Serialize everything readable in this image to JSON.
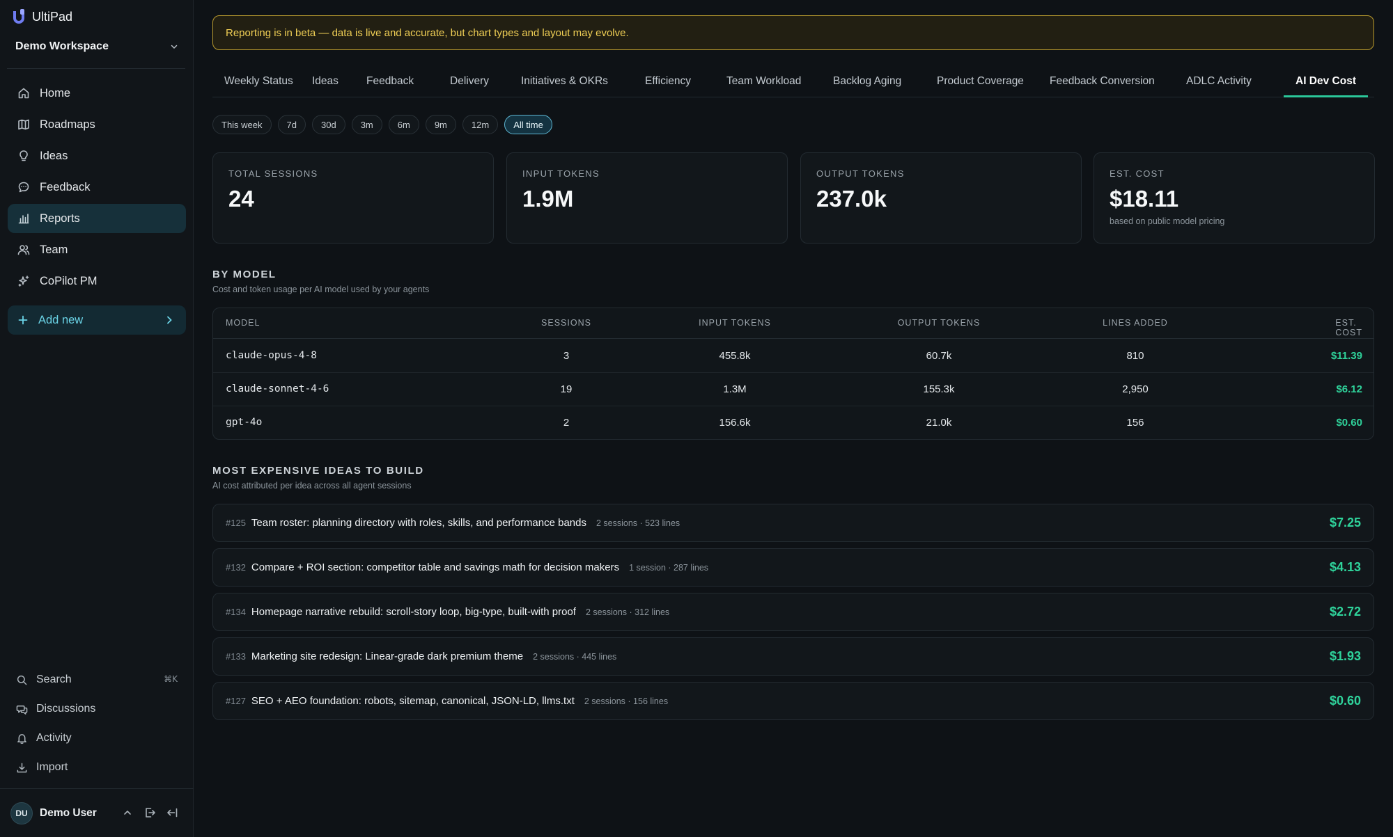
{
  "app": {
    "name": "UltiPad"
  },
  "workspace": {
    "name": "Demo Workspace"
  },
  "nav": {
    "items": [
      {
        "label": "Home",
        "icon": "home-icon"
      },
      {
        "label": "Roadmaps",
        "icon": "map-icon"
      },
      {
        "label": "Ideas",
        "icon": "lightbulb-icon"
      },
      {
        "label": "Feedback",
        "icon": "chat-icon"
      },
      {
        "label": "Reports",
        "icon": "bar-chart-icon",
        "active": true
      },
      {
        "label": "Team",
        "icon": "users-icon"
      },
      {
        "label": "CoPilot PM",
        "icon": "sparkle-icon"
      }
    ],
    "add_new": "Add new"
  },
  "bottom_nav": {
    "search": "Search",
    "search_shortcut": "⌘K",
    "discussions": "Discussions",
    "activity": "Activity",
    "import": "Import"
  },
  "user": {
    "initials": "DU",
    "name": "Demo User"
  },
  "banner": "Reporting is in beta — data is live and accurate, but chart types and layout may evolve.",
  "tabs": [
    "Weekly Status",
    "Ideas",
    "Feedback",
    "Delivery",
    "Initiatives & OKRs",
    "Efficiency",
    "Team Workload",
    "Backlog Aging",
    "Product Coverage",
    "Feedback Conversion",
    "ADLC Activity",
    "AI Dev Cost"
  ],
  "active_tab": "AI Dev Cost",
  "filters": [
    "This week",
    "7d",
    "30d",
    "3m",
    "6m",
    "9m",
    "12m",
    "All time"
  ],
  "active_filter": "All time",
  "stats": [
    {
      "label": "TOTAL SESSIONS",
      "value": "24",
      "sub": ""
    },
    {
      "label": "INPUT TOKENS",
      "value": "1.9M",
      "sub": ""
    },
    {
      "label": "OUTPUT TOKENS",
      "value": "237.0k",
      "sub": ""
    },
    {
      "label": "EST. COST",
      "value": "$18.11",
      "sub": "based on public model pricing"
    }
  ],
  "by_model": {
    "title": "BY MODEL",
    "subtitle": "Cost and token usage per AI model used by your agents",
    "columns": [
      "MODEL",
      "SESSIONS",
      "INPUT TOKENS",
      "OUTPUT TOKENS",
      "LINES ADDED",
      "EST. COST"
    ],
    "rows": [
      [
        "claude-opus-4-8",
        "3",
        "455.8k",
        "60.7k",
        "810",
        "$11.39"
      ],
      [
        "claude-sonnet-4-6",
        "19",
        "1.3M",
        "155.3k",
        "2,950",
        "$6.12"
      ],
      [
        "gpt-4o",
        "2",
        "156.6k",
        "21.0k",
        "156",
        "$0.60"
      ]
    ]
  },
  "expensive_ideas": {
    "title": "MOST EXPENSIVE IDEAS TO BUILD",
    "subtitle": "AI cost attributed per idea across all agent sessions",
    "items": [
      {
        "num": "#125",
        "title": "Team roster: planning directory with roles, skills, and performance bands",
        "meta": "2 sessions · 523 lines",
        "cost": "$7.25"
      },
      {
        "num": "#132",
        "title": "Compare + ROI section: competitor table and savings math for decision makers",
        "meta": "1 session · 287 lines",
        "cost": "$4.13"
      },
      {
        "num": "#134",
        "title": "Homepage narrative rebuild: scroll-story loop, big-type, built-with proof",
        "meta": "2 sessions · 312 lines",
        "cost": "$2.72"
      },
      {
        "num": "#133",
        "title": "Marketing site redesign: Linear-grade dark premium theme",
        "meta": "2 sessions · 445 lines",
        "cost": "$1.93"
      },
      {
        "num": "#127",
        "title": "SEO + AEO foundation: robots, sitemap, canonical, JSON-LD, llms.txt",
        "meta": "2 sessions · 156 lines",
        "cost": "$0.60"
      }
    ]
  },
  "colors": {
    "accent": "#2bc79a",
    "cost": "#2fd39b",
    "banner": "#f0cf55",
    "link": "#6ad3e6"
  }
}
